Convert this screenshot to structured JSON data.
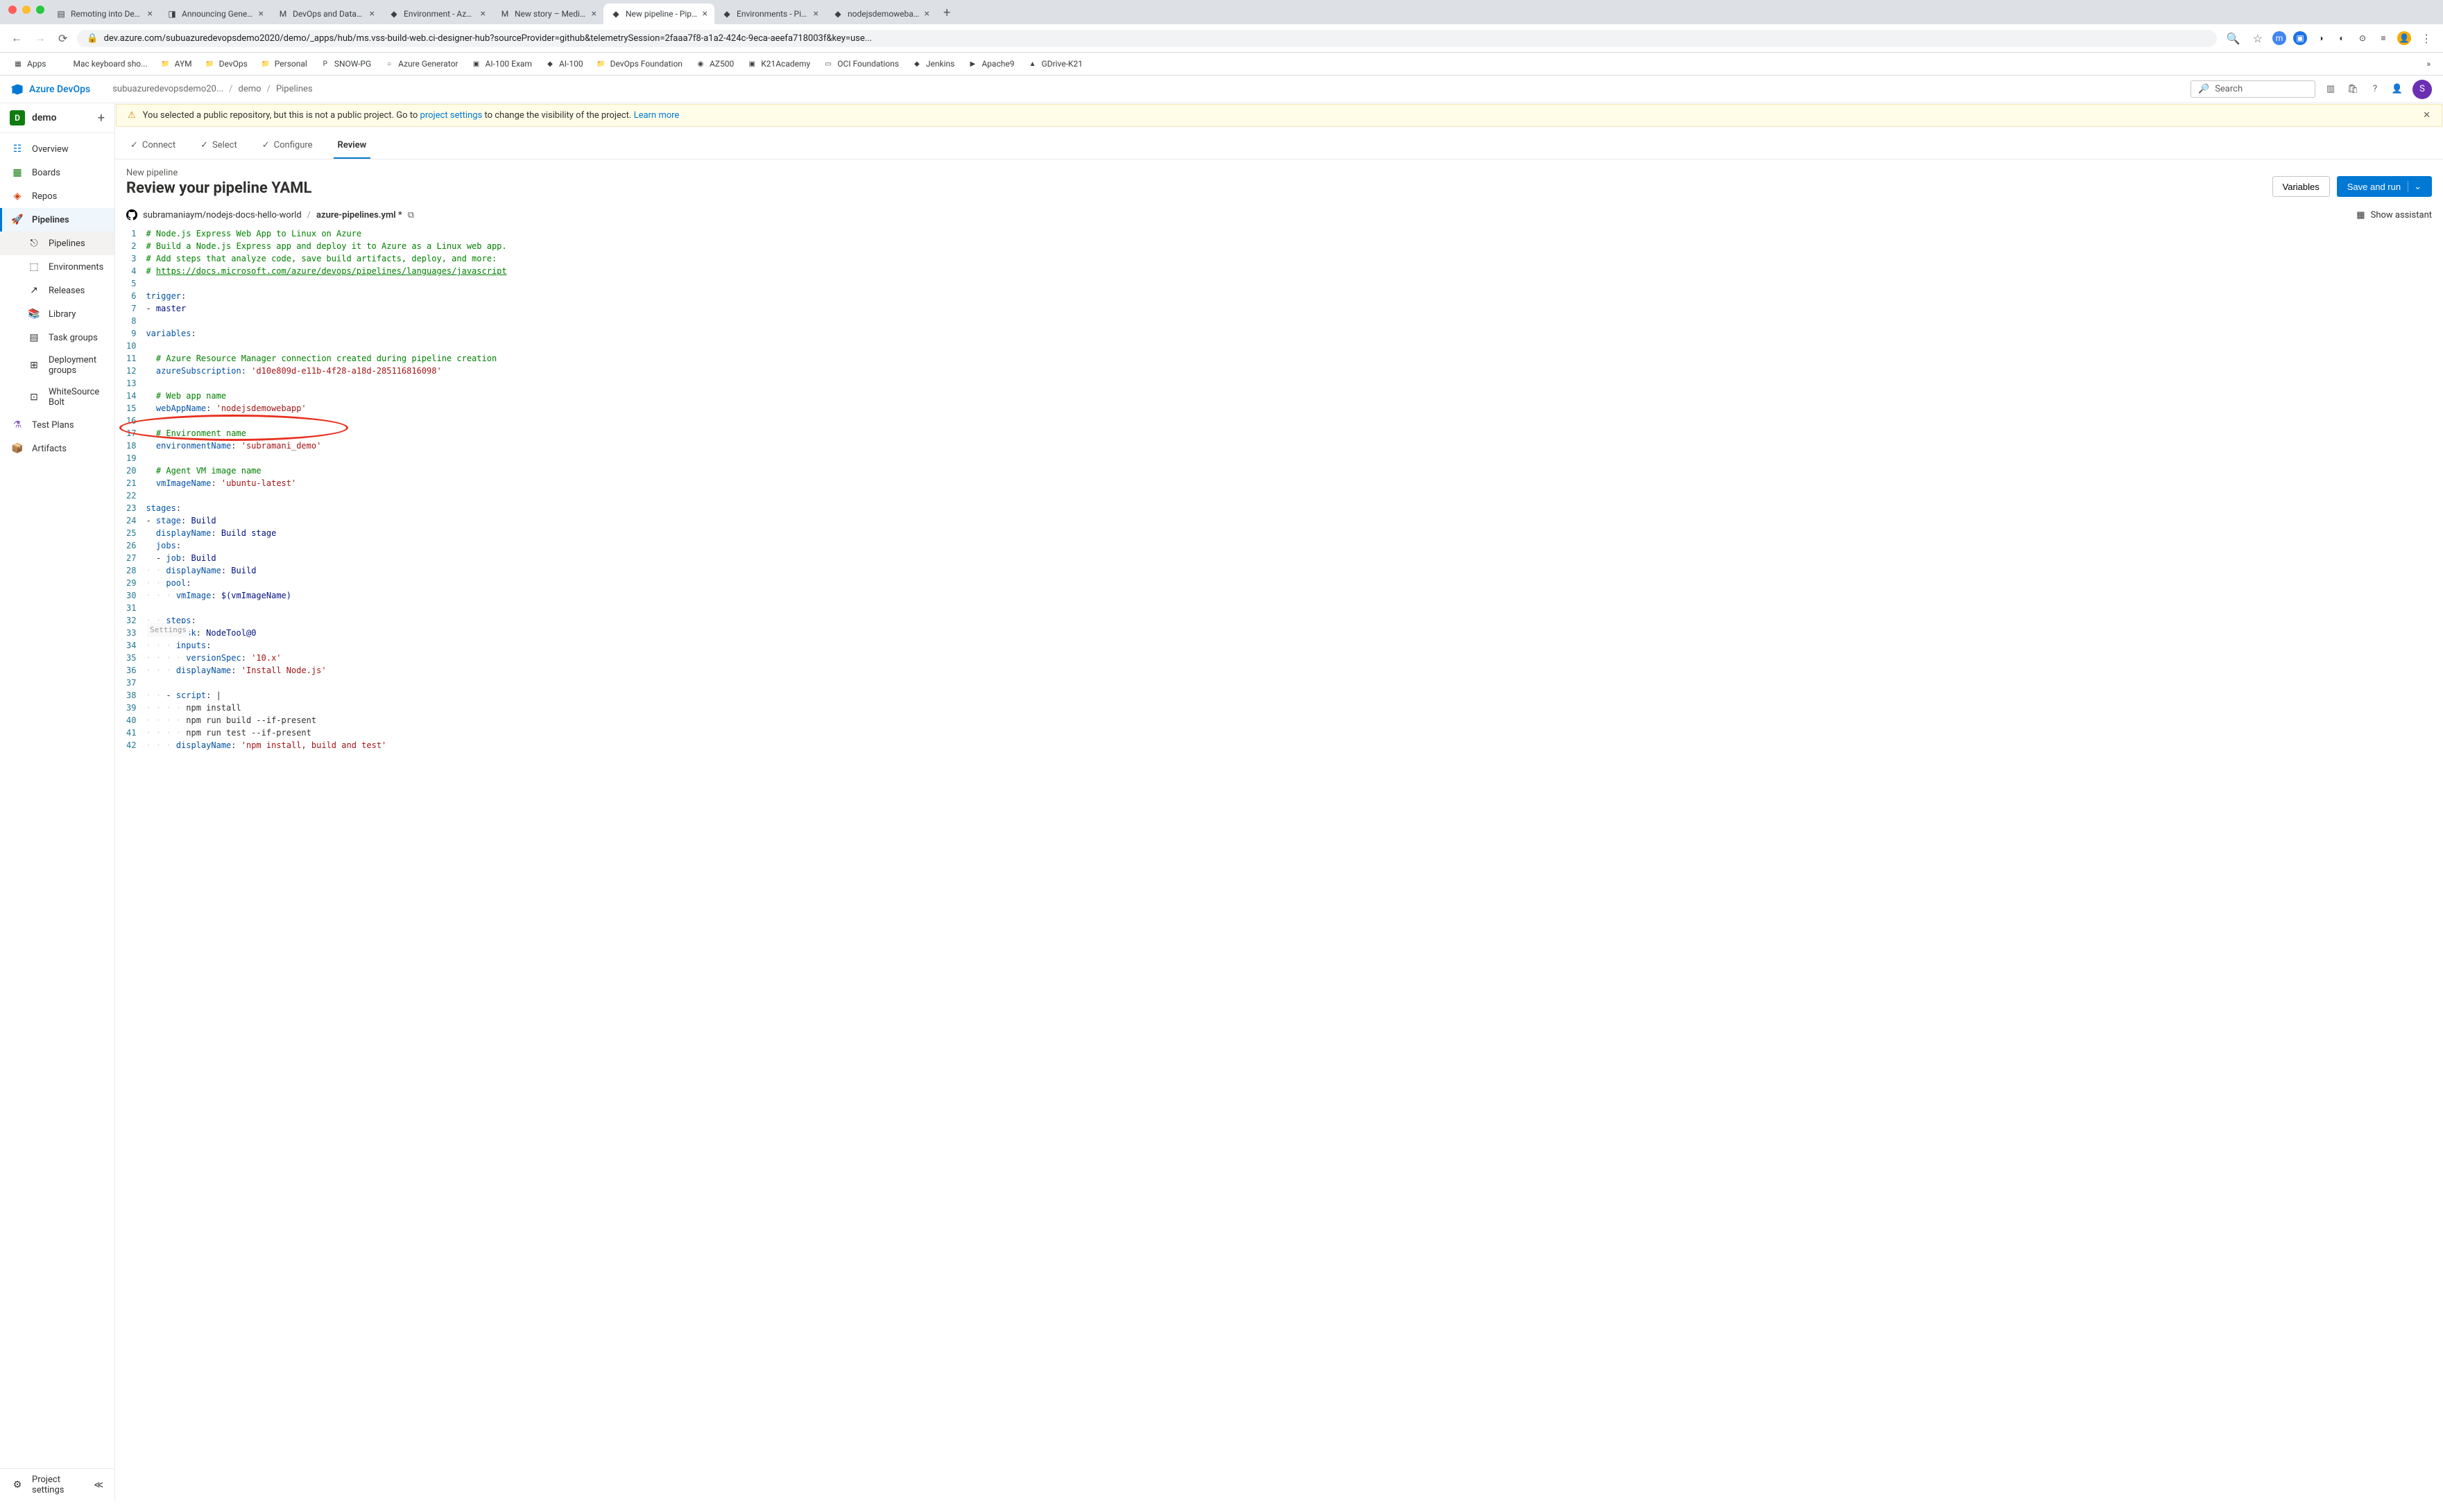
{
  "browser": {
    "tabs": [
      {
        "title": "Remoting into DevOps",
        "fav": "▤"
      },
      {
        "title": "Announcing General Av",
        "fav": "◨"
      },
      {
        "title": "DevOps and Databases",
        "fav": "M"
      },
      {
        "title": "Environment - Azure Pi",
        "fav": "◆"
      },
      {
        "title": "New story – Medium",
        "fav": "M"
      },
      {
        "title": "New pipeline - Pipelines",
        "fav": "◆",
        "active": true
      },
      {
        "title": "Environments - Pipeline",
        "fav": "◆"
      },
      {
        "title": "nodejsdemowebapp - ",
        "fav": "◆"
      }
    ],
    "url": "dev.azure.com/subuazuredevopsdemo2020/demo/_apps/hub/ms.vss-build-web.ci-designer-hub?sourceProvider=github&telemetrySession=2faaa7f8-a1a2-424c-9eca-aeefa718003f&key=use...",
    "bookmarks": [
      {
        "label": "Apps",
        "icon": "▦"
      },
      {
        "label": "Mac keyboard sho...",
        "icon": ""
      },
      {
        "label": "AYM",
        "icon": "📁"
      },
      {
        "label": "DevOps",
        "icon": "📁"
      },
      {
        "label": "Personal",
        "icon": "📁"
      },
      {
        "label": "SNOW-PG",
        "icon": "P"
      },
      {
        "label": "Azure Generator",
        "icon": "○"
      },
      {
        "label": "AI-100 Exam",
        "icon": "▣"
      },
      {
        "label": "AI-100",
        "icon": "◆"
      },
      {
        "label": "DevOps Foundation",
        "icon": "📁"
      },
      {
        "label": "AZ500",
        "icon": "◉"
      },
      {
        "label": "K21Academy",
        "icon": "▣"
      },
      {
        "label": "OCI Foundations",
        "icon": "▭"
      },
      {
        "label": "Jenkins",
        "icon": "◆"
      },
      {
        "label": "Apache9",
        "icon": "▶"
      },
      {
        "label": "GDrive-K21",
        "icon": "▲"
      }
    ]
  },
  "azure": {
    "product": "Azure DevOps",
    "breadcrumbs": [
      "subuazuredevopsdemo20...",
      "demo",
      "Pipelines"
    ],
    "search_placeholder": "Search",
    "avatar_initial": "S"
  },
  "sidebar": {
    "project": {
      "initial": "D",
      "name": "demo"
    },
    "items": [
      {
        "icon": "☷",
        "label": "Overview",
        "color": "#0078d4"
      },
      {
        "icon": "▦",
        "label": "Boards",
        "color": "#107c10"
      },
      {
        "icon": "◈",
        "label": "Repos",
        "color": "#d83b01"
      },
      {
        "icon": "🚀",
        "label": "Pipelines",
        "active": true,
        "color": "#0078d4",
        "subs": [
          {
            "label": "Pipelines",
            "icon": "⎋"
          },
          {
            "label": "Environments",
            "icon": "⬚"
          },
          {
            "label": "Releases",
            "icon": "↗"
          },
          {
            "label": "Library",
            "icon": "📚"
          },
          {
            "label": "Task groups",
            "icon": "▤"
          },
          {
            "label": "Deployment groups",
            "icon": "⊞"
          },
          {
            "label": "WhiteSource Bolt",
            "icon": "⊡"
          }
        ]
      },
      {
        "icon": "⚗",
        "label": "Test Plans",
        "color": "#8661c5"
      },
      {
        "icon": "📦",
        "label": "Artifacts",
        "color": "#e3008c"
      }
    ],
    "footer": {
      "settings": "Project settings"
    }
  },
  "banner": {
    "prefix": "You selected a public repository, but this is not a public project. Go to ",
    "link1": "project settings",
    "mid": " to change the visibility of the project. ",
    "link2": "Learn more"
  },
  "wizard": {
    "steps": [
      "Connect",
      "Select",
      "Configure",
      "Review"
    ],
    "active_index": 3
  },
  "page": {
    "new_label": "New pipeline",
    "title": "Review your pipeline YAML",
    "variables_btn": "Variables",
    "save_btn": "Save and run"
  },
  "file": {
    "repo": "subramaniaym/nodejs-docs-hello-world",
    "name": "azure-pipelines.yml *",
    "assistant": "Show assistant"
  },
  "yaml": {
    "l1": "# Node.js Express Web App to Linux on Azure",
    "l2": "# Build a Node.js Express app and deploy it to Azure as a Linux web app.",
    "l3": "# Add steps that analyze code, save build artifacts, deploy, and more:",
    "l4": "# ",
    "l4_link": "https://docs.microsoft.com/azure/devops/pipelines/languages/javascript",
    "l6_k": "trigger",
    "l6_c": ":",
    "l7_d": "- ",
    "l7_v": "master",
    "l9_k": "variables",
    "l9_c": ":",
    "l11": "# Azure Resource Manager connection created during pipeline creation",
    "l12_k": "azureSubscription",
    "l12_c": ": ",
    "l12_v": "'d10e809d-e11b-4f28-a18d-285116816098'",
    "l14": "# Web app name",
    "l15_k": "webAppName",
    "l15_c": ": ",
    "l15_v": "'nodejsdemowebapp'",
    "l17": "# Environment name",
    "l18_k": "environmentName",
    "l18_c": ": ",
    "l18_v": "'subramani_demo'",
    "l20": "# Agent VM image name",
    "l21_k": "vmImageName",
    "l21_c": ": ",
    "l21_v": "'ubuntu-latest'",
    "l23_k": "stages",
    "l23_c": ":",
    "l24_d": "- ",
    "l24_k": "stage",
    "l24_c": ": ",
    "l24_v": "Build",
    "l25_k": "displayName",
    "l25_c": ": ",
    "l25_v": "Build stage",
    "l26_k": "jobs",
    "l26_c": ":",
    "l27_d": "- ",
    "l27_k": "job",
    "l27_c": ": ",
    "l27_v": "Build",
    "l28_k": "displayName",
    "l28_c": ": ",
    "l28_v": "Build",
    "l29_k": "pool",
    "l29_c": ":",
    "l30_k": "vmImage",
    "l30_c": ": ",
    "l30_v": "$(vmImageName)",
    "l32_k": "steps",
    "l32_c": ":",
    "settings_hint": "Settings",
    "l33_d": "- ",
    "l33_k": "task",
    "l33_c": ": ",
    "l33_v": "NodeTool@0",
    "l34_k": "inputs",
    "l34_c": ":",
    "l35_k": "versionSpec",
    "l35_c": ": ",
    "l35_v": "'10.x'",
    "l36_k": "displayName",
    "l36_c": ": ",
    "l36_v": "'Install Node.js'",
    "l38_d": "- ",
    "l38_k": "script",
    "l38_c": ": |",
    "l39": "npm install",
    "l40": "npm run build --if-present",
    "l41": "npm run test --if-present",
    "l42_k": "displayName",
    "l42_c": ": ",
    "l42_v": "'npm install, build and test'"
  }
}
